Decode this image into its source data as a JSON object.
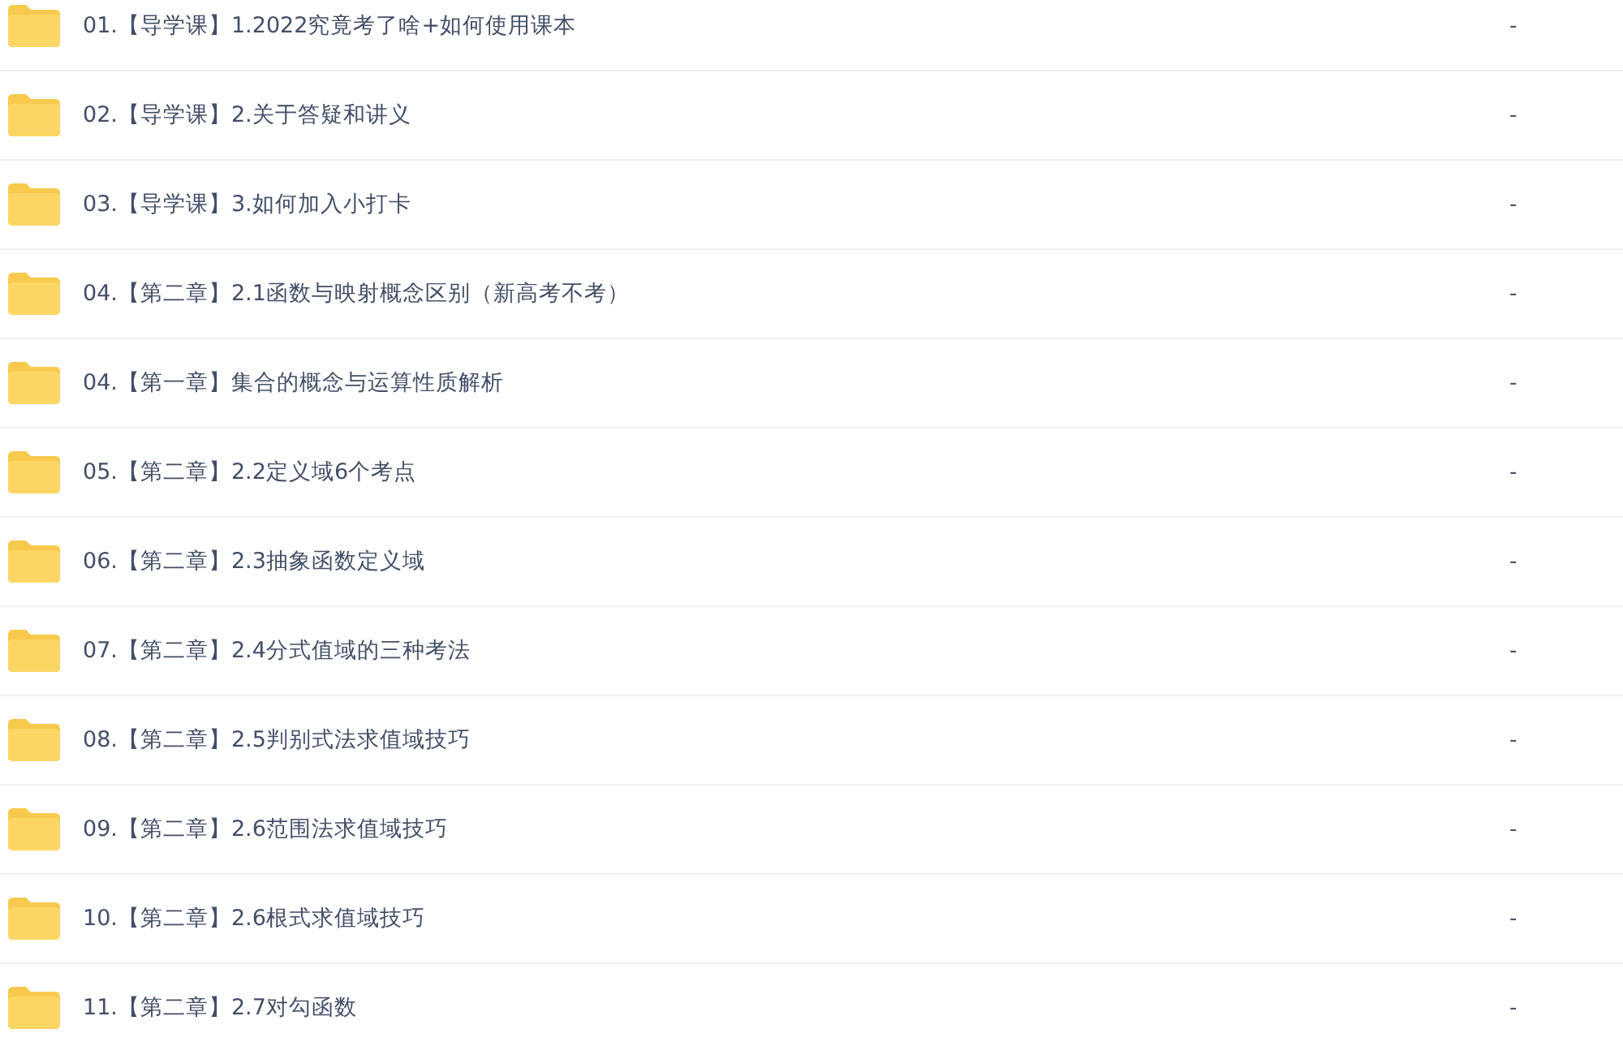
{
  "files": [
    {
      "name": "01.【导学课】1.2022究竟考了啥+如何使用课本",
      "size": "-"
    },
    {
      "name": "02.【导学课】2.关于答疑和讲义",
      "size": "-"
    },
    {
      "name": "03.【导学课】3.如何加入小打卡",
      "size": "-"
    },
    {
      "name": "04.【第二章】2.1函数与映射概念区别（新高考不考）",
      "size": "-"
    },
    {
      "name": "04.【第一章】集合的概念与运算性质解析",
      "size": "-"
    },
    {
      "name": "05.【第二章】2.2定义域6个考点",
      "size": "-"
    },
    {
      "name": "06.【第二章】2.3抽象函数定义域",
      "size": "-"
    },
    {
      "name": "07.【第二章】2.4分式值域的三种考法",
      "size": "-"
    },
    {
      "name": "08.【第二章】2.5判别式法求值域技巧",
      "size": "-"
    },
    {
      "name": "09.【第二章】2.6范围法求值域技巧",
      "size": "-"
    },
    {
      "name": "10.【第二章】2.6根式求值域技巧",
      "size": "-"
    },
    {
      "name": "11.【第二章】2.7对勾函数",
      "size": "-"
    }
  ]
}
